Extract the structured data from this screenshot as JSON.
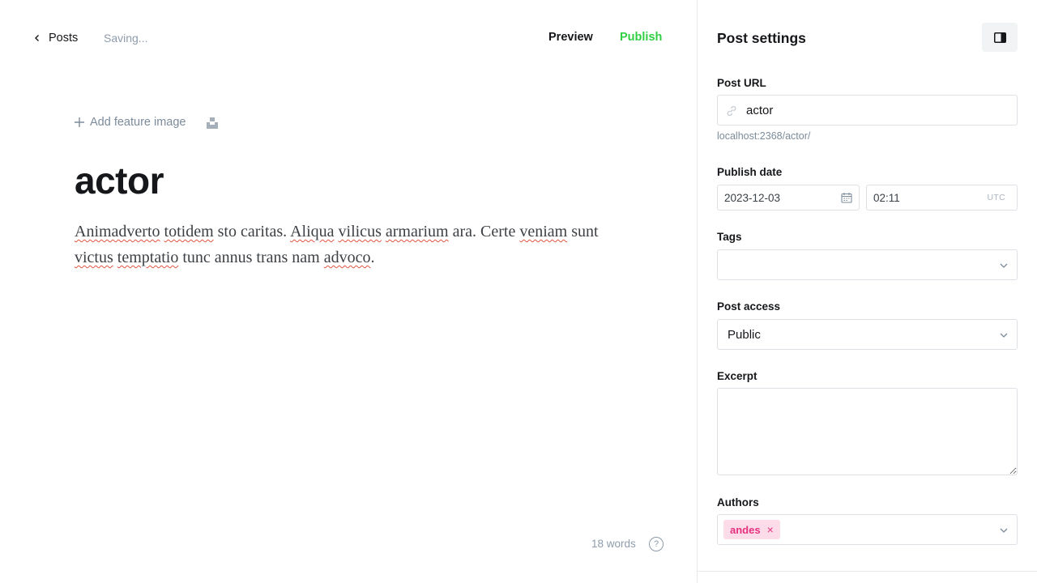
{
  "topbar": {
    "back_label": "Posts",
    "status": "Saving...",
    "preview_label": "Preview",
    "publish_label": "Publish"
  },
  "editor": {
    "feature_image_label": "Add feature image",
    "title": "actor",
    "body_segments": [
      {
        "text": "Animadverto",
        "misspelled": true
      },
      {
        "text": " ",
        "misspelled": false
      },
      {
        "text": "totidem",
        "misspelled": true
      },
      {
        "text": " sto caritas. ",
        "misspelled": false
      },
      {
        "text": "Aliqua",
        "misspelled": true
      },
      {
        "text": " ",
        "misspelled": false
      },
      {
        "text": "vilicus",
        "misspelled": true
      },
      {
        "text": " ",
        "misspelled": false
      },
      {
        "text": "armarium",
        "misspelled": true
      },
      {
        "text": " ara. Certe ",
        "misspelled": false
      },
      {
        "text": "veniam",
        "misspelled": true
      },
      {
        "text": " sunt ",
        "misspelled": false
      },
      {
        "text": "victus",
        "misspelled": true
      },
      {
        "text": " ",
        "misspelled": false
      },
      {
        "text": "temptatio",
        "misspelled": true
      },
      {
        "text": " tunc annus trans nam ",
        "misspelled": false
      },
      {
        "text": "advoco",
        "misspelled": true
      },
      {
        "text": ".",
        "misspelled": false
      }
    ],
    "word_count": "18 words",
    "help_glyph": "?"
  },
  "settings": {
    "title": "Post settings",
    "post_url": {
      "label": "Post URL",
      "value": "actor",
      "hint": "localhost:2368/actor/"
    },
    "publish_date": {
      "label": "Publish date",
      "date": "2023-12-03",
      "time": "02:11",
      "timezone": "UTC"
    },
    "tags": {
      "label": "Tags",
      "value": ""
    },
    "post_access": {
      "label": "Post access",
      "value": "Public"
    },
    "excerpt": {
      "label": "Excerpt",
      "value": ""
    },
    "authors": {
      "label": "Authors",
      "chips": [
        {
          "name": "andes",
          "remove_glyph": "×"
        }
      ]
    }
  },
  "colors": {
    "publish": "#30cf43",
    "author_chip_bg": "#fddcea",
    "author_chip_text": "#e4327f",
    "muted": "#8e9cac",
    "spellcheck": "#e25440"
  },
  "icons": [
    "chevron-left-icon",
    "plus-icon",
    "unsplash-icon",
    "help-icon",
    "sidebar-toggle-icon",
    "link-icon",
    "calendar-icon",
    "chevron-down-icon",
    "close-icon"
  ]
}
